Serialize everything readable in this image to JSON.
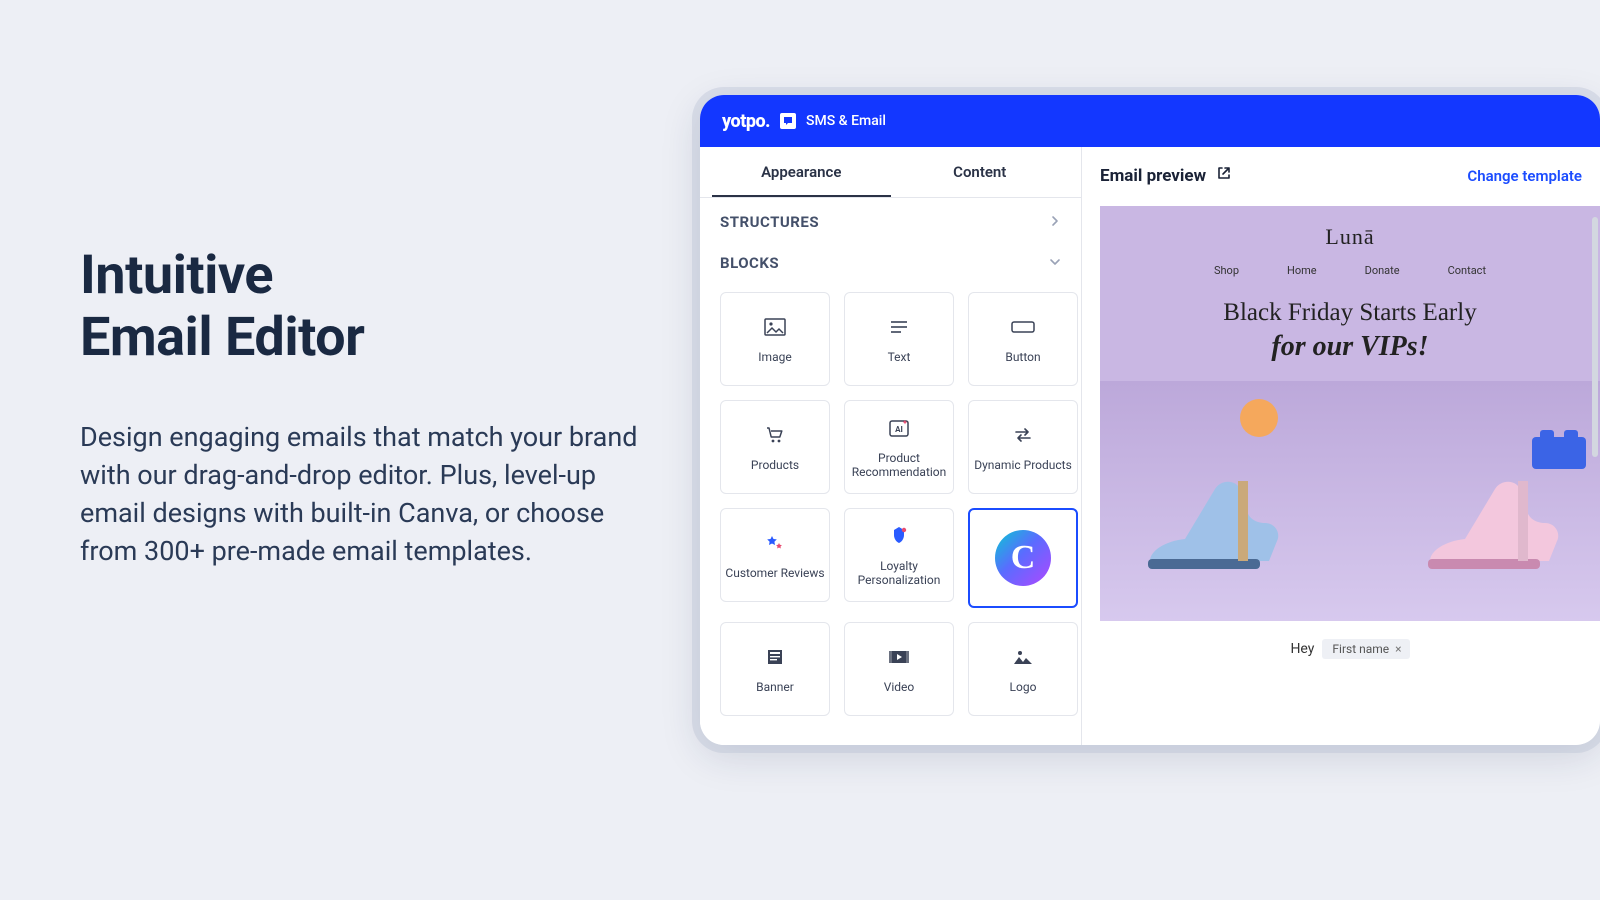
{
  "hero": {
    "title_line1": "Intuitive",
    "title_line2": "Email Editor",
    "body": "Design engaging emails that match your brand with our drag-and-drop editor. Plus, level-up email designs with built-in Canva, or choose from 300+ pre-made email templates."
  },
  "app": {
    "brand": "yotpo.",
    "product": "SMS & Email",
    "tabs": {
      "appearance": "Appearance",
      "content": "Content"
    },
    "sections": {
      "structures": "STRUCTURES",
      "blocks": "BLOCKS"
    },
    "blocks": {
      "image": "Image",
      "text": "Text",
      "button": "Button",
      "products": "Products",
      "product_recommendation": "Product Recommendation",
      "dynamic_products": "Dynamic Products",
      "customer_reviews": "Customer Reviews",
      "loyalty_personalization": "Loyalty Personalization",
      "canva": "",
      "banner": "Banner",
      "video": "Video",
      "logo": "Logo"
    }
  },
  "preview": {
    "title": "Email preview",
    "change": "Change template",
    "store": "Lunā",
    "nav": {
      "shop": "Shop",
      "home": "Home",
      "donate": "Donate",
      "contact": "Contact"
    },
    "headline1": "Black Friday Starts Early",
    "headline2": "for our VIPs!",
    "greeting": "Hey",
    "chip_label": "First name"
  }
}
